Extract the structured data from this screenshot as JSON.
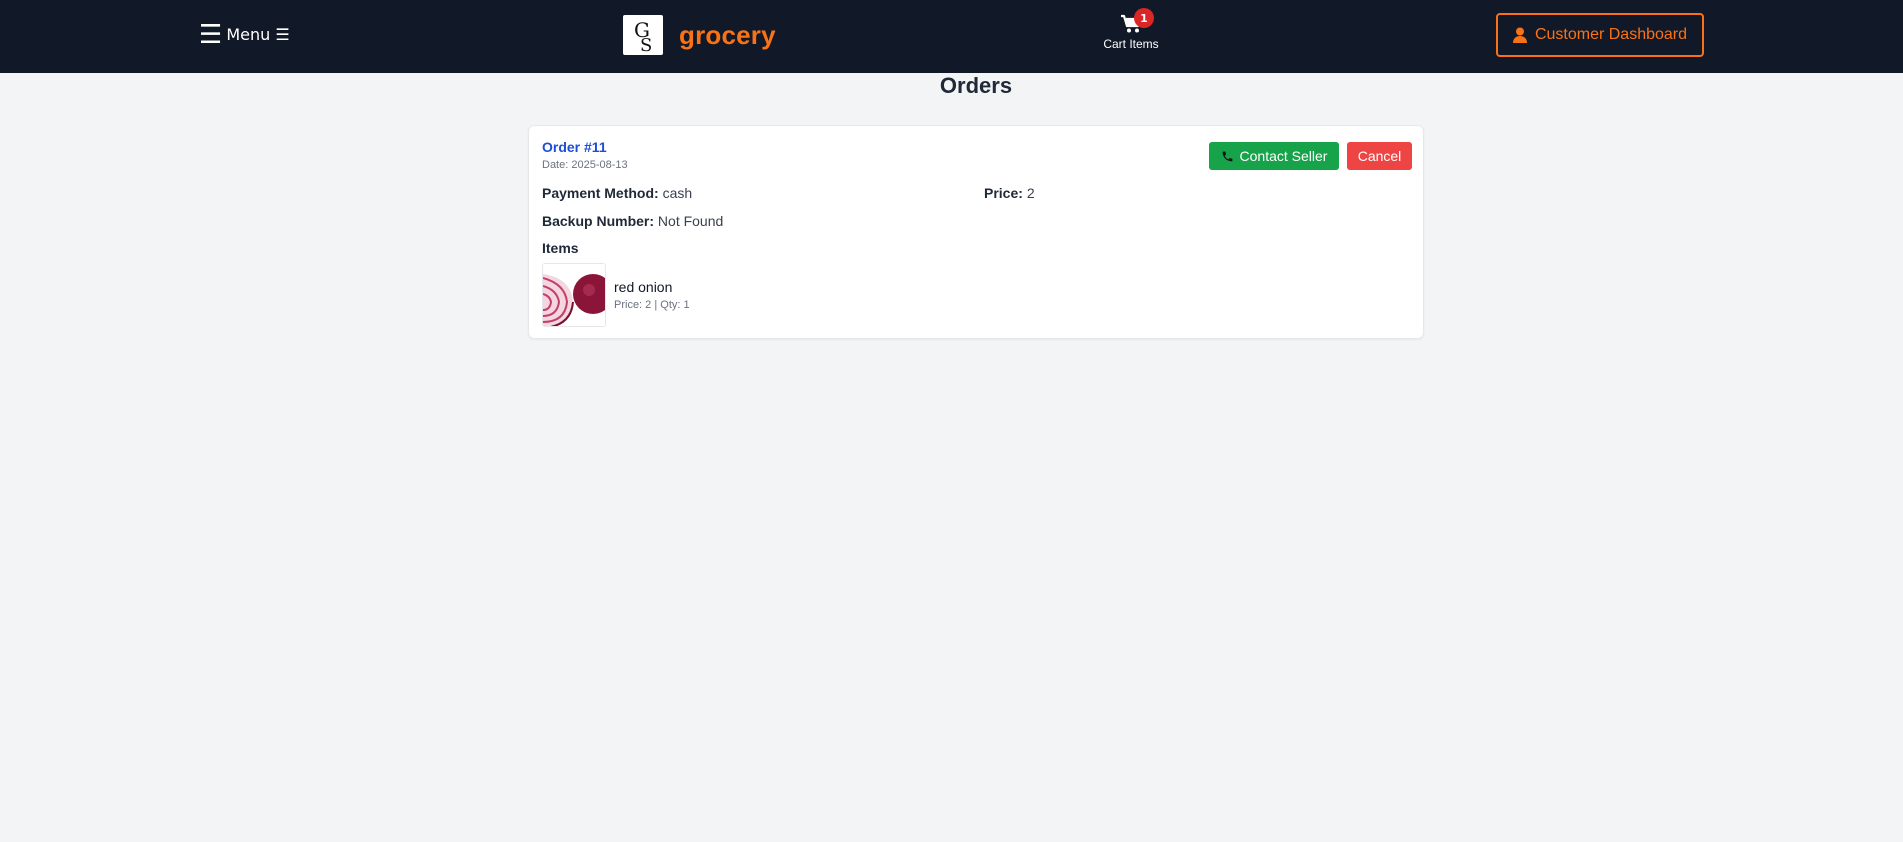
{
  "header": {
    "menu_icon": "☰",
    "menu_label": "Menu ☰",
    "logo_icon": "gs-monogram-logo",
    "brand": "grocery",
    "cart_count": "1",
    "cart_label": "Cart Items",
    "dashboard_label": "Customer Dashboard"
  },
  "page": {
    "title": "Orders"
  },
  "order": {
    "id": "Order #11",
    "date": "Date: 2025-08-13",
    "contact_label": "Contact Seller",
    "cancel_label": "Cancel",
    "payment_label": "Payment Method:",
    "payment_value": "cash",
    "price_label": "Price:",
    "price_value": "2",
    "backup_label": "Backup Number:",
    "backup_value": "Not Found",
    "items_title": "Items",
    "items": [
      {
        "name": "red onion",
        "meta": "Price: 2 | Qty: 1"
      }
    ]
  },
  "colors": {
    "header_bg": "#111827",
    "accent": "#f97316",
    "link": "#1d4ed8",
    "contact": "#16a34a",
    "cancel": "#ef4444",
    "badge": "#dc2626"
  }
}
